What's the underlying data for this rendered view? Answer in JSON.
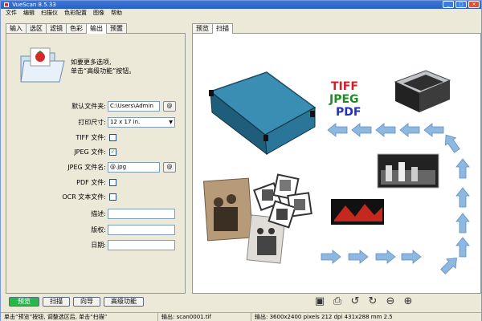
{
  "window": {
    "title": "VueScan 8.5.33",
    "controls": [
      "_",
      "□",
      "×"
    ]
  },
  "menu": [
    "文件",
    "编辑",
    "扫描仪",
    "色彩配置",
    "图像",
    "帮助"
  ],
  "left_tabs": [
    "输入",
    "选区",
    "滤镜",
    "色彩",
    "输出",
    "预置"
  ],
  "left_active_tab": "输出",
  "right_tabs": [
    "预览",
    "扫描"
  ],
  "right_active_tab": "扫描",
  "hint": [
    "如要更多选项,",
    "单击“高级功能”按钮。"
  ],
  "form": {
    "default_folder_label": "默认文件夹:",
    "default_folder_value": "C:\\Users\\Admin",
    "print_size_label": "打印尺寸:",
    "print_size_value": "12 x 17 in.",
    "tiff_label": "TIFF 文件:",
    "tiff_checked": false,
    "jpeg_label": "JPEG 文件:",
    "jpeg_checked": true,
    "jpeg_name_label": "JPEG 文件名:",
    "jpeg_name_value": "@.jpg",
    "pdf_label": "PDF 文件:",
    "pdf_checked": false,
    "ocr_label": "OCR 文本文件:",
    "ocr_checked": false,
    "description_label": "描述:",
    "copyright_label": "版权:",
    "date_label": "日期:",
    "browse_glyph": "@"
  },
  "buttons": {
    "preview": "预览",
    "scan": "扫描",
    "wizard": "向导",
    "advanced": "高级功能"
  },
  "toolbar_icons": [
    "save-icon",
    "print-icon",
    "rotate-left-icon",
    "rotate-right-icon",
    "zoom-out-icon",
    "zoom-in-icon"
  ],
  "status": {
    "left": "单击“预览”按钮, 调整选区后, 单击“扫描”",
    "output": "输出: scan0001.tif",
    "input": "输出: 3600x2400 pixels 212 dpi 431x288 mm 2.5"
  },
  "illustration": {
    "formats": [
      "TIFF",
      "JPEG",
      "PDF"
    ],
    "format_colors": [
      "#d0202a",
      "#1e8c24",
      "#2233b8"
    ],
    "arrow_color": "#8fb8e0"
  }
}
